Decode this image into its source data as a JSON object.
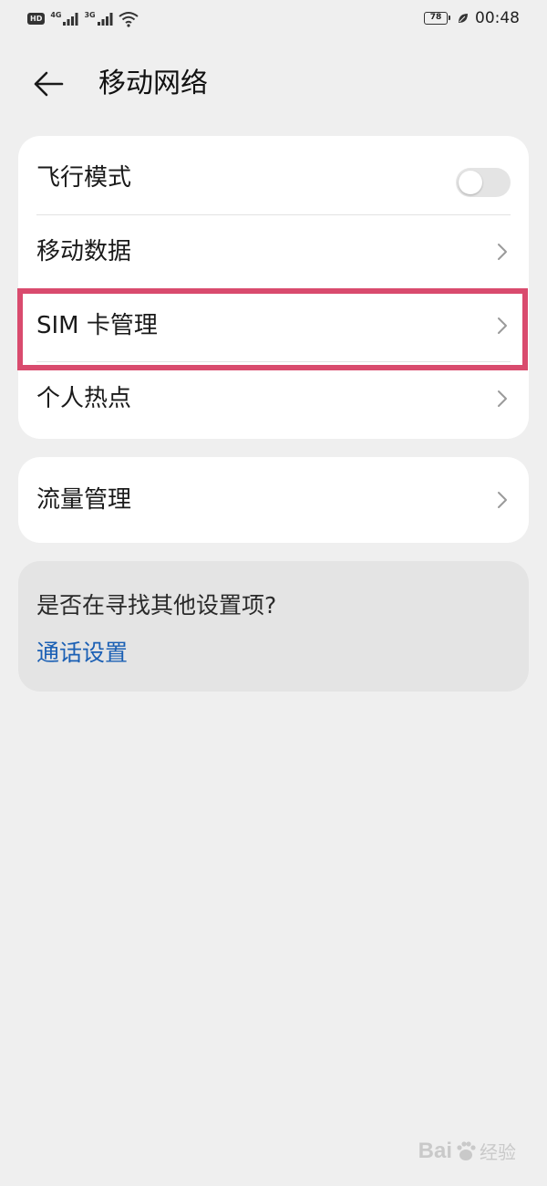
{
  "status_bar": {
    "hd_badge": "HD",
    "signal_1_network": "4G",
    "signal_2_network": "3G",
    "battery_level": "78",
    "time": "00:48"
  },
  "header": {
    "title": "移动网络",
    "back_icon": "arrow-left-icon"
  },
  "settings_group_1": {
    "items": [
      {
        "label": "飞行模式",
        "control": "toggle",
        "toggle_on": false
      },
      {
        "label": "移动数据",
        "control": "chevron"
      },
      {
        "label": "SIM 卡管理",
        "control": "chevron",
        "highlighted": true
      },
      {
        "label": "个人热点",
        "control": "chevron"
      }
    ]
  },
  "settings_group_2": {
    "items": [
      {
        "label": "流量管理",
        "control": "chevron"
      }
    ]
  },
  "suggestion": {
    "question": "是否在寻找其他设置项?",
    "link_label": "通话设置"
  },
  "watermark": {
    "brand": "Bai",
    "suffix": "经验"
  },
  "colors": {
    "background": "#efefef",
    "card": "#ffffff",
    "suggestion_card": "#e4e4e4",
    "link": "#1a5fb4",
    "highlight_border": "#d94b6e"
  }
}
